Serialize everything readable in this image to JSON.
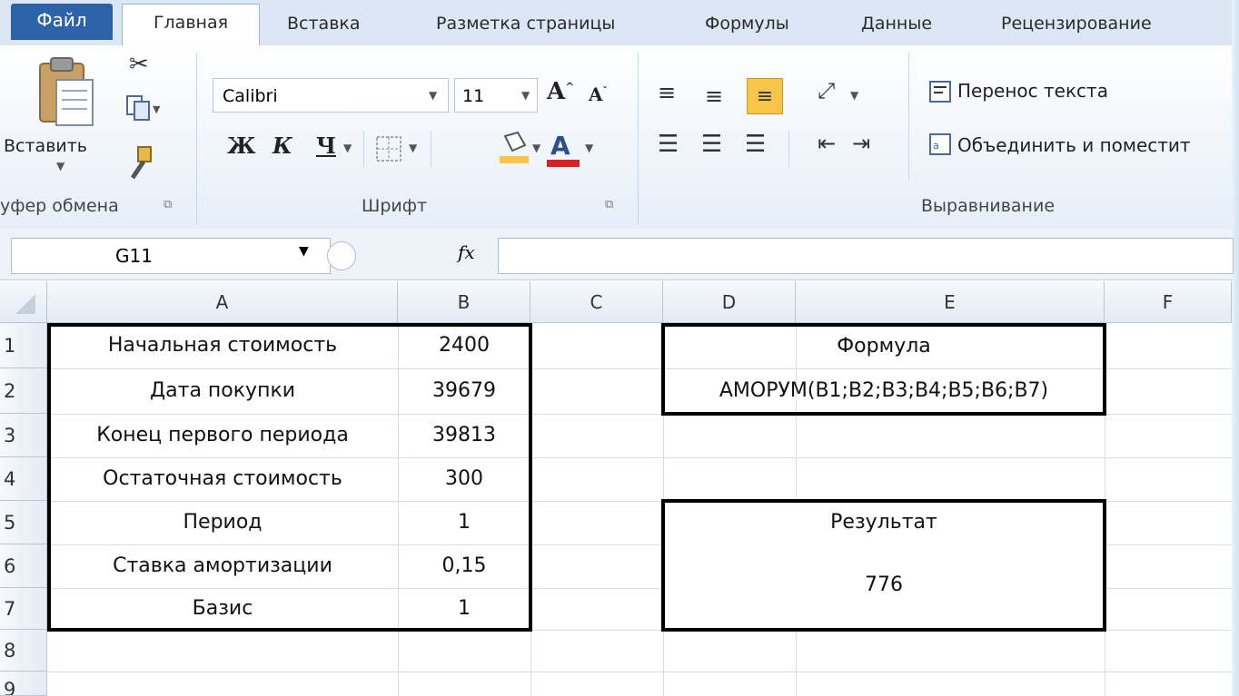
{
  "tabs": {
    "file": "Файл",
    "items": [
      "Главная",
      "Вставка",
      "Разметка страницы",
      "Формулы",
      "Данные",
      "Рецензирование"
    ]
  },
  "ribbon": {
    "paste_label": "Вставить",
    "clipboard_label": "уфер обмена",
    "font_name": "Calibri",
    "font_size": "11",
    "bold": "Ж",
    "italic": "К",
    "underline": "Ч",
    "font_group_label": "Шрифт",
    "wrap_text": "Перенос текста",
    "merge_center": "Объединить и поместит",
    "align_group_label": "Выравнивание"
  },
  "formula_bar": {
    "cell_ref": "G11",
    "fx": "fx",
    "content": ""
  },
  "sheet": {
    "columns": [
      "A",
      "B",
      "C",
      "D",
      "E",
      "F"
    ],
    "rows": [
      "1",
      "2",
      "3",
      "4",
      "5",
      "6",
      "7",
      "8",
      "9"
    ],
    "labels": [
      "Начальная стоимость",
      "Дата покупки",
      "Конец первого периода",
      "Остаточная стоимость",
      "Период",
      "Ставка амортизации",
      "Базис"
    ],
    "values": [
      "2400",
      "39679",
      "39813",
      "300",
      "1",
      "0,15",
      "1"
    ],
    "formula_header": "Формула",
    "formula_text": "АМОРУМ(B1;B2;B3;B4;B5;B6;B7)",
    "result_header": "Результат",
    "result_value": "776"
  },
  "colors": {
    "file_tab": "#2d63a8",
    "highlight": "#f7c548",
    "font_color_bar": "#d92020"
  }
}
